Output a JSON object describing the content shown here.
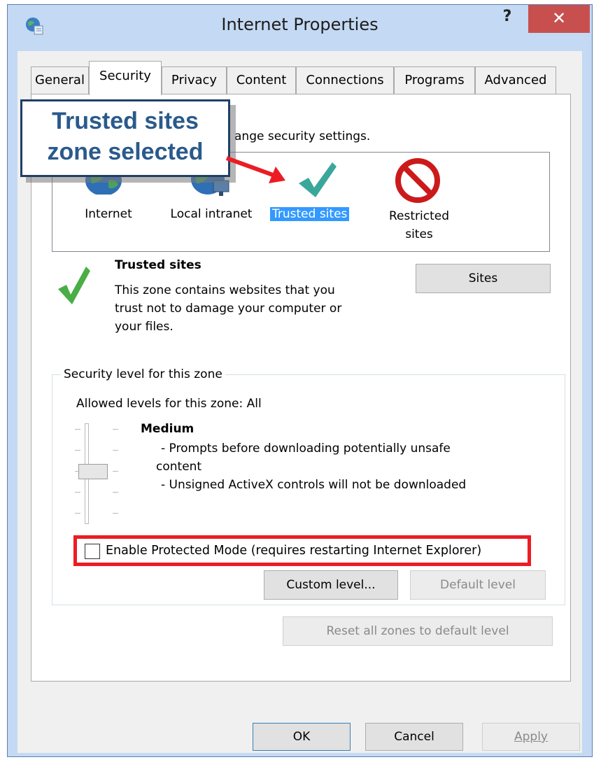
{
  "window": {
    "title": "Internet Properties",
    "help_label": "?",
    "close_label": "✕",
    "app_icon": "internet-options-globe-icon"
  },
  "tabs": [
    {
      "label": "General",
      "selected": false
    },
    {
      "label": "Security",
      "selected": true
    },
    {
      "label": "Privacy",
      "selected": false
    },
    {
      "label": "Content",
      "selected": false
    },
    {
      "label": "Connections",
      "selected": false
    },
    {
      "label": "Programs",
      "selected": false
    },
    {
      "label": "Advanced",
      "selected": false
    }
  ],
  "security": {
    "instruction_visible": "ange security settings.",
    "zones": [
      {
        "label": "Internet",
        "icon": "globe-icon"
      },
      {
        "label": "Local intranet",
        "icon": "intranet-globe-icon"
      },
      {
        "label": "Trusted sites",
        "icon": "checkmark-icon",
        "selected": true
      },
      {
        "label": "Restricted sites",
        "icon": "no-entry-icon"
      }
    ],
    "zone_title": "Trusted sites",
    "zone_description": [
      "This zone contains websites that you",
      "trust not to damage your computer or",
      "your files."
    ],
    "sites_button": "Sites",
    "group_title": "Security level for this zone",
    "allowed_levels": "Allowed levels for this zone: All",
    "level_name": "Medium",
    "level_desc": [
      "- Prompts before downloading potentially unsafe",
      "content",
      "- Unsigned ActiveX controls will not be downloaded"
    ],
    "protected_mode_label": "Enable Protected Mode (requires restarting Internet Explorer)",
    "protected_mode_checked": false,
    "custom_level": "Custom level...",
    "default_level": "Default level",
    "reset_all": "Reset all zones to default level"
  },
  "footer": {
    "ok": "OK",
    "cancel": "Cancel",
    "apply": "Apply"
  },
  "callout": {
    "lines": [
      "Trusted sites",
      "zone selected"
    ],
    "color": "#2a5a8c"
  },
  "colors": {
    "highlight": "#ec1c24",
    "selection": "#3399ff",
    "close": "#c7504f"
  }
}
